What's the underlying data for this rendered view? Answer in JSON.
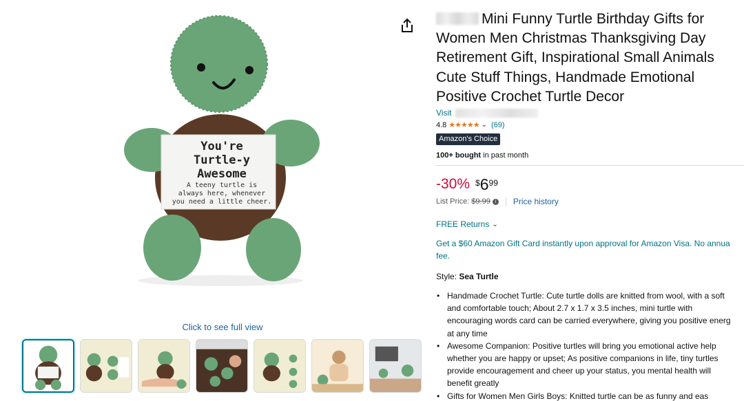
{
  "gallery": {
    "main_image_alt": "Crochet turtle holding a card",
    "card_line1": "You're",
    "card_line2": "Turtle-y",
    "card_line3": "Awesome",
    "card_small1": "A teeny turtle is",
    "card_small2": "always here, whenever",
    "card_small3": "you need a little cheer.",
    "click_full_view": "Click to see full view",
    "thumbnails": [
      {
        "icon": "turtle-front"
      },
      {
        "icon": "turtle-infographic"
      },
      {
        "icon": "turtle-hand"
      },
      {
        "icon": "turtle-knitting"
      },
      {
        "icon": "turtle-support"
      },
      {
        "icon": "turtle-woman"
      },
      {
        "icon": "turtle-desk"
      }
    ]
  },
  "product": {
    "title": "Mini Funny Turtle Birthday Gifts for Women Men Christmas Thanksgiving Day Retirement Gift, Inspirational Small Animals Cute Stuff Things, Handmade Emotional Positive Crochet Turtle Decor",
    "visit_label": "Visit",
    "rating_value": "4.8",
    "stars": "★★★★★",
    "rating_count": "(69)",
    "badge": "Amazon's Choice",
    "bought_bold": "100+ bought",
    "bought_rest": " in past month",
    "discount": "-30%",
    "currency": "$",
    "price_whole": "6",
    "price_cents": "99",
    "list_price_label": "List Price:",
    "list_price": "$9.99",
    "price_history": "Price history",
    "free_returns": "FREE Returns",
    "promo_line1": "Get a $60 Amazon Gift Card instantly upon approval for Amazon Visa. No annua",
    "promo_line2": "fee.",
    "style_label": "Style: ",
    "style_value": "Sea Turtle",
    "bullets": [
      "Handmade Crochet Turtle: Cute turtle dolls are knitted from wool, with a soft",
      "and comfortable touch; About 2.7 x 1.7 x 3.5 inches, mini turtle with",
      "encouraging words card can be carried everywhere, giving you positive energ",
      "at any time",
      "Awesome Companion: Positive turtles will bring you emotional active help",
      "whether you are happy or upset; As positive companions in life, tiny turtles",
      "provide encouragement and cheer up your status, you mental health will",
      "benefit greatly",
      "Gifts for Women Men Girls Boys: Knitted turtle can be as funny and eas"
    ]
  },
  "colors": {
    "link": "#007185",
    "discount": "#cc0c39",
    "star": "#de7921",
    "badge_bg": "#232f3e",
    "turtle_green": "#6aa578",
    "shell_brown": "#5a3a26"
  }
}
